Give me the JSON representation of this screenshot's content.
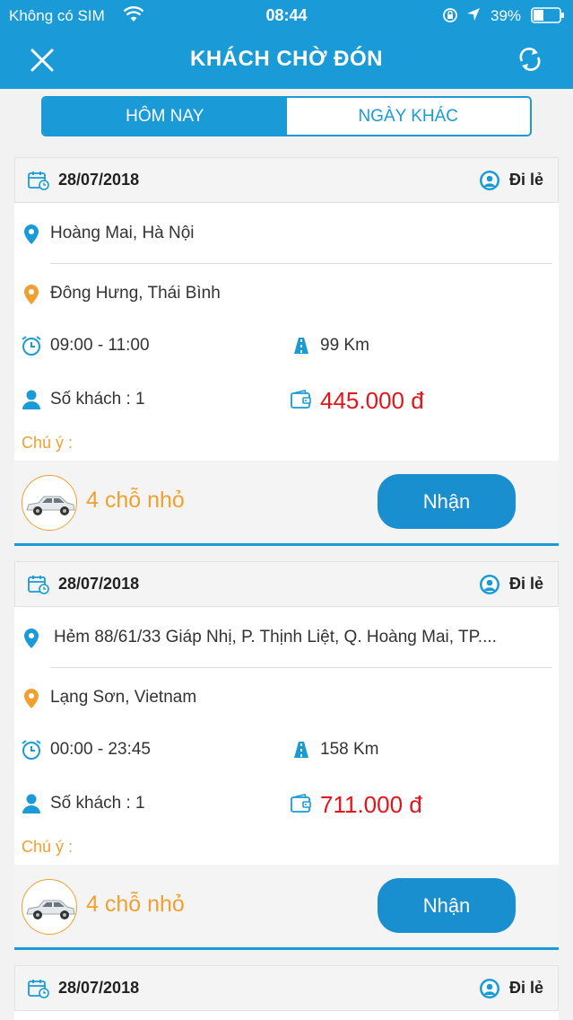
{
  "status_bar": {
    "carrier": "Không có SIM",
    "time": "08:44",
    "battery": "39%"
  },
  "header": {
    "title": "KHÁCH CHỜ ĐÓN"
  },
  "tabs": [
    {
      "label": "HÔM NAY",
      "active": true
    },
    {
      "label": "NGÀY KHÁC",
      "active": false
    }
  ],
  "rides": [
    {
      "date": "28/07/2018",
      "trip_type": "Đi lẻ",
      "pickup": "Hoàng Mai, Hà Nội",
      "dropoff": "Đông Hưng, Thái Bình",
      "time_window": "09:00 - 11:00",
      "distance": "99 Km",
      "passengers": "Số khách :  1",
      "price": "445.000 đ",
      "note_label": "Chú ý :",
      "car_type": "4 chỗ nhỏ",
      "accept_label": "Nhận"
    },
    {
      "date": "28/07/2018",
      "trip_type": "Đi lẻ",
      "pickup": "Hẻm 88/61/33 Giáp Nhị, P. Thịnh Liệt, Q. Hoàng Mai, TP....",
      "dropoff": "Lạng Sơn, Vietnam",
      "time_window": "00:00 - 23:45",
      "distance": "158 Km",
      "passengers": "Số khách :  1",
      "price": "711.000 đ",
      "note_label": "Chú ý :",
      "car_type": "4 chỗ nhỏ",
      "accept_label": "Nhận"
    },
    {
      "date": "28/07/2018",
      "trip_type": "Đi lẻ"
    }
  ],
  "colors": {
    "primary": "#1a9bd7",
    "accent": "#f0a030",
    "price": "#e4141b"
  }
}
